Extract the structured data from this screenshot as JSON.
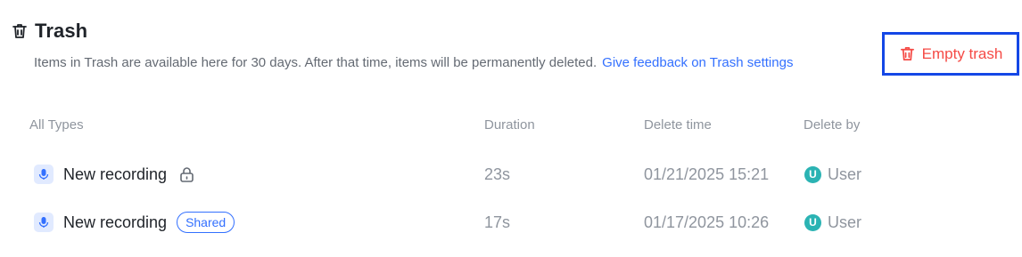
{
  "header": {
    "title": "Trash",
    "description": "Items in Trash are available here for 30 days. After that time, items will be permanently deleted.",
    "feedback_link": "Give feedback on Trash settings"
  },
  "actions": {
    "empty_trash_label": "Empty trash"
  },
  "colors": {
    "accent": "#3370ff",
    "danger": "#f54a45",
    "highlight_border": "#1447e6",
    "avatar": "#2bb3b3"
  },
  "table": {
    "columns": [
      "All Types",
      "Duration",
      "Delete time",
      "Delete by"
    ],
    "rows": [
      {
        "type_icon": "microphone-icon",
        "name": "New recording",
        "status_icon": "lock-icon",
        "badge": "",
        "duration": "23s",
        "delete_time": "01/21/2025 15:21",
        "avatar_initial": "U",
        "delete_by": "User"
      },
      {
        "type_icon": "microphone-icon",
        "name": "New recording",
        "status_icon": "",
        "badge": "Shared",
        "duration": "17s",
        "delete_time": "01/17/2025 10:26",
        "avatar_initial": "U",
        "delete_by": "User"
      }
    ]
  }
}
